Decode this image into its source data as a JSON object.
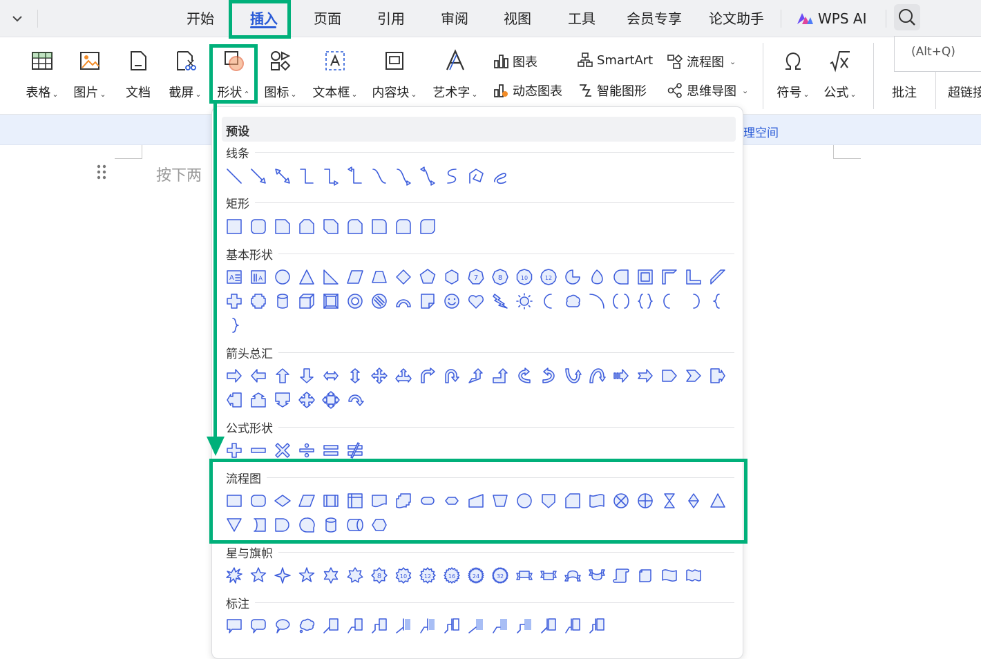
{
  "tabs": [
    {
      "label": "开始",
      "name": "tab-home"
    },
    {
      "label": "插入",
      "name": "tab-insert",
      "active": true
    },
    {
      "label": "页面",
      "name": "tab-page"
    },
    {
      "label": "引用",
      "name": "tab-references"
    },
    {
      "label": "审阅",
      "name": "tab-review"
    },
    {
      "label": "视图",
      "name": "tab-view"
    },
    {
      "label": "工具",
      "name": "tab-tools"
    },
    {
      "label": "会员专享",
      "name": "tab-member"
    },
    {
      "label": "论文助手",
      "name": "tab-paper-assistant"
    }
  ],
  "wps_ai": {
    "label": "WPS AI"
  },
  "search": {
    "tooltip": "(Alt+Q)"
  },
  "ribbon": {
    "table": "表格",
    "picture": "图片",
    "document": "文档",
    "screenshot": "截屏",
    "shape": "形状",
    "icons": "图标",
    "textbox": "文本框",
    "content_block": "内容块",
    "wordart": "艺术字",
    "chart": "图表",
    "dynamic_chart": "动态图表",
    "smartart": "SmartArt",
    "smart_graphic": "智能图形",
    "flowchart": "流程图",
    "mindmap": "思维导图",
    "symbol": "符号",
    "formula": "公式",
    "comment": "批注",
    "hyperlink": "超链接"
  },
  "notice": {
    "text": "理空间"
  },
  "document": {
    "placeholder": "按下两"
  },
  "panel": {
    "header": "预设",
    "categories": {
      "lines": "线条",
      "rectangles": "矩形",
      "basic": "基本形状",
      "arrows": "箭头总汇",
      "equation": "公式形状",
      "flowchart": "流程图",
      "stars": "星与旗帜",
      "callouts": "标注"
    }
  },
  "colors": {
    "highlight": "#00b07a",
    "shape_stroke": "#3b5bdb",
    "shape_fill": "#e8eefc",
    "accent": "#2a5bd7"
  }
}
